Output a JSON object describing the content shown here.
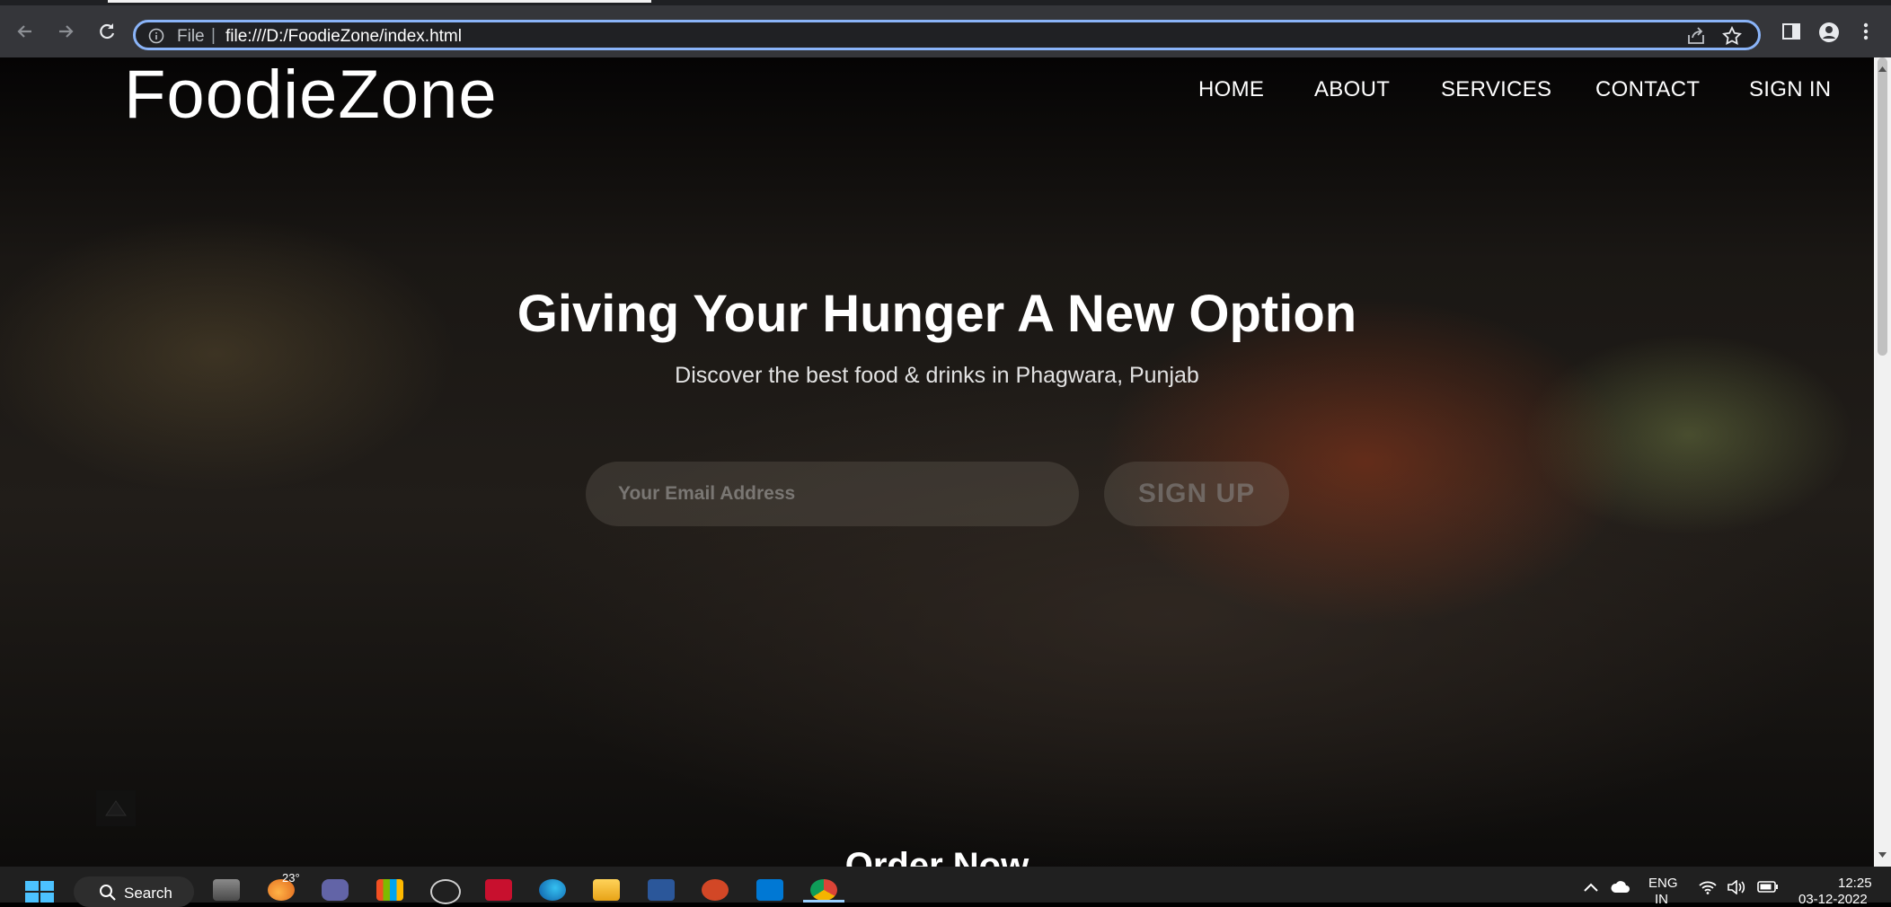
{
  "browser": {
    "address": {
      "scheme_label": "File",
      "separator": "|",
      "url": "file:///D:/FoodieZone/index.html"
    }
  },
  "site": {
    "brand": "FoodieZone",
    "nav": [
      "HOME",
      "ABOUT",
      "SERVICES",
      "CONTACT",
      "SIGN IN"
    ],
    "hero": {
      "title": "Giving Your Hunger A New Option",
      "subtitle": "Discover the best food & drinks in Phagwara, Punjab",
      "email_placeholder": "Your Email Address",
      "signup_label": "SIGN UP"
    },
    "next_section_title": "Order Now"
  },
  "taskbar": {
    "search_label": "Search",
    "weather_temp": "23°",
    "language": "ENG",
    "region": "IN",
    "time": "12:25",
    "date": "03-12-2022"
  },
  "colors": {
    "omnibox_focus": "#8ab4f8",
    "toolbar": "#35363a",
    "taskbar": "#202020"
  }
}
